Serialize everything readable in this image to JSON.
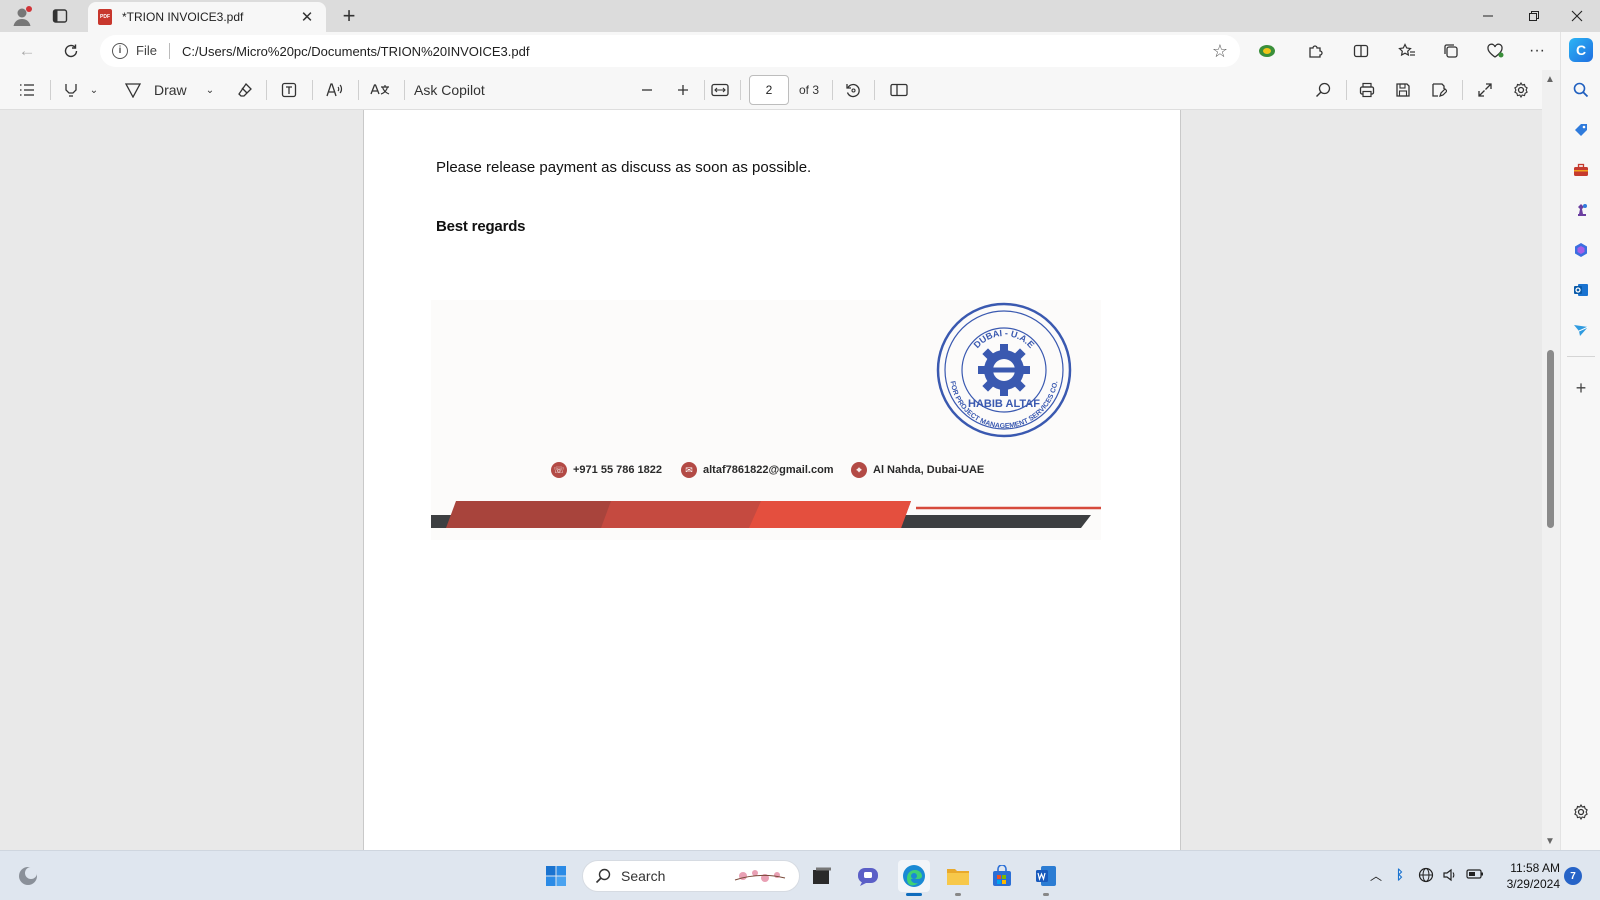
{
  "browser": {
    "tab_title": "*TRION INVOICE3.pdf",
    "tab_icon_text": "PDF",
    "omnibox_file_label": "File",
    "url": "C:/Users/Micro%20pc/Documents/TRION%20INVOICE3.pdf"
  },
  "pdf_toolbar": {
    "draw_label": "Draw",
    "ask_copilot_label": "Ask Copilot",
    "page_current": "2",
    "page_total_label": "of 3"
  },
  "document": {
    "release_text": "Please release payment as discuss as soon as possible.",
    "regards_text": "Best regards",
    "footer": {
      "phone": "+971 55 786 1822",
      "email": "altaf7861822@gmail.com",
      "address": "Al Nahda, Dubai-UAE"
    },
    "stamp": {
      "top_text": "DUBAI - U.A.E",
      "name": "HABIB ALTAF",
      "bottom_text": "FOR PROJECT MANAGEMENT SERVICES CO.",
      "color": "#3a59b0"
    }
  },
  "taskbar": {
    "search_label": "Search",
    "time": "11:58 AM",
    "date": "3/29/2024",
    "notification_count": "7"
  },
  "colors": {
    "accent": "#0f6cbd",
    "footer_red": "#d64a3c",
    "footer_dark": "#3d3f41"
  }
}
